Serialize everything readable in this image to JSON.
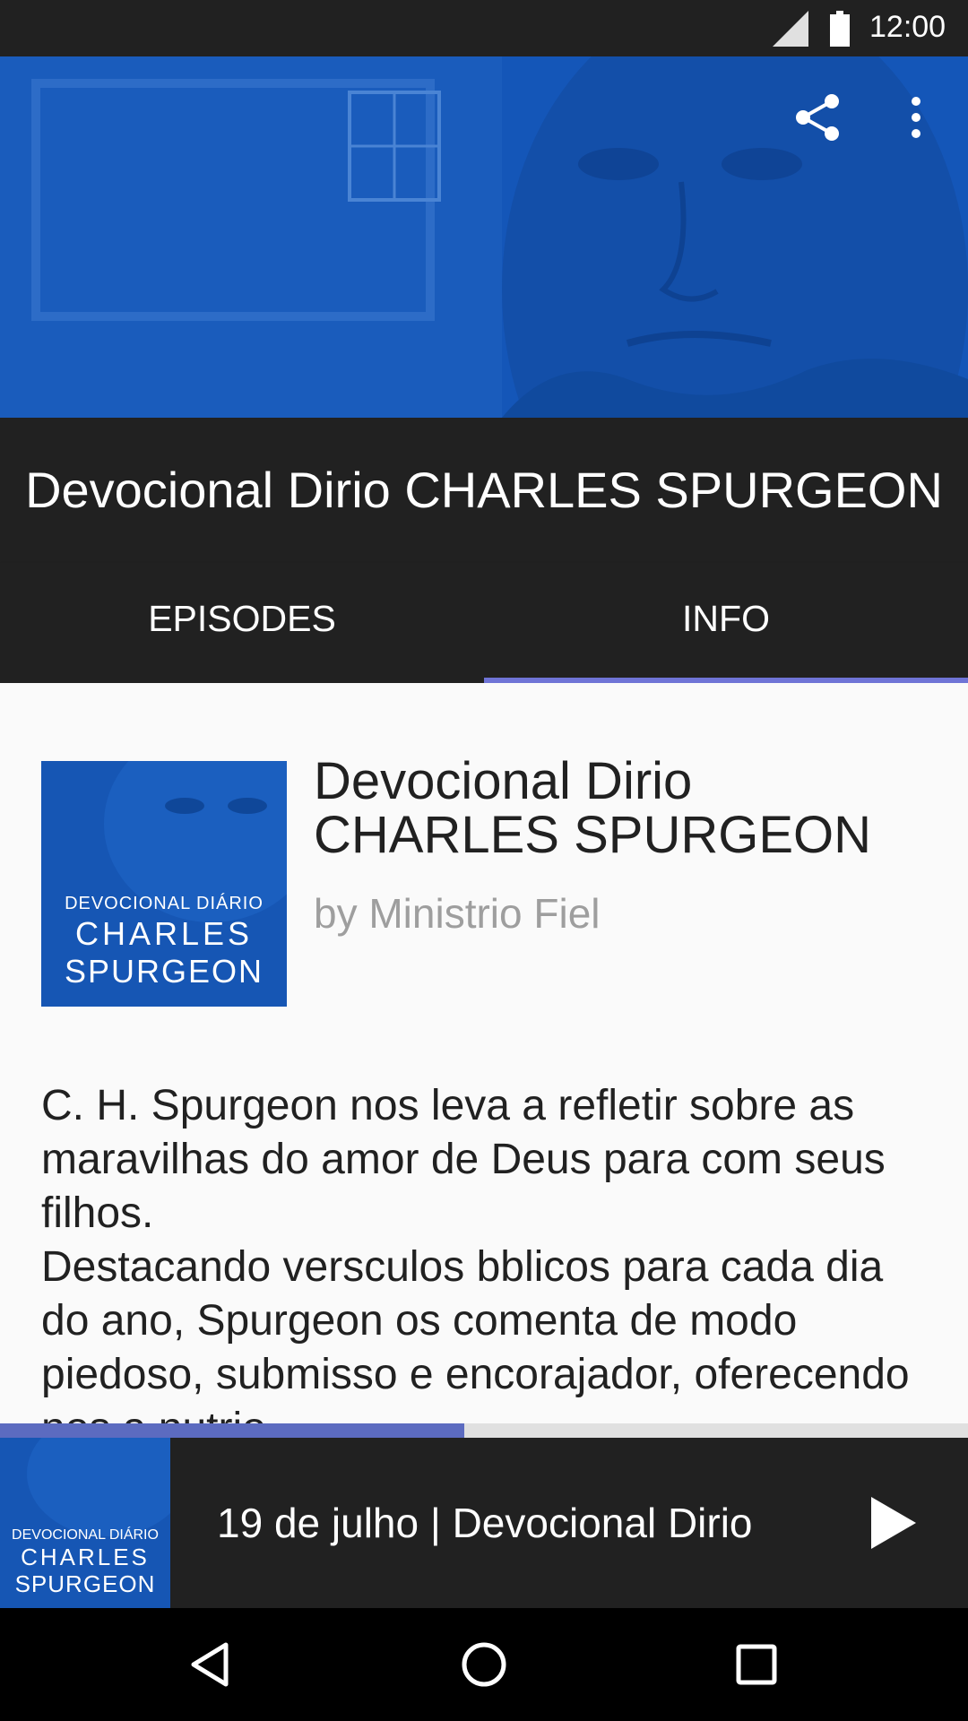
{
  "status_bar": {
    "time": "12:00",
    "icons": [
      "signal-icon",
      "battery-icon"
    ]
  },
  "toolbar": {
    "actions": [
      "share-icon",
      "more-vert-icon"
    ]
  },
  "podcast": {
    "header_title": "Devocional Dirio CHARLES SPURGEON",
    "title_line1": "Devocional Dirio",
    "title_line2": "CHARLES SPURGEON",
    "author": "by Ministrio Fiel",
    "cover": {
      "line1": "DEVOCIONAL DIÁRIO",
      "line2": "CHARLES",
      "line3": "SPURGEON"
    },
    "description": "C. H. Spurgeon nos leva a refletir sobre as maravilhas do amor de Deus para com seus filhos.\nDestacando versculos bblicos para cada dia do ano, Spurgeon os comenta de modo piedoso, submisso e encorajador, oferecendo nos a nutrio"
  },
  "tabs": [
    {
      "label": "EPISODES",
      "selected": false
    },
    {
      "label": "INFO",
      "selected": true
    }
  ],
  "player": {
    "episode_title": "19 de julho | Devocional Dirio",
    "progress": 0.48,
    "cover": {
      "line1": "DEVOCIONAL DIÁRIO",
      "line2": "CHARLES",
      "line3": "SPURGEON"
    },
    "action_icon": "play-icon"
  },
  "nav_bar": {
    "icons": [
      "back-icon",
      "home-icon",
      "recents-icon"
    ]
  },
  "colors": {
    "accent": "#6f74d6",
    "brand_blue": "#1456b8",
    "dark_bar": "#212121"
  }
}
